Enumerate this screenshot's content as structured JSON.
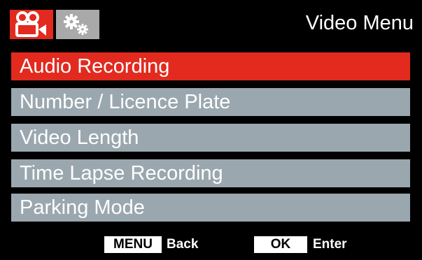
{
  "header": {
    "title": "Video Menu",
    "tabs": [
      {
        "icon": "video-camera-icon",
        "active": true
      },
      {
        "icon": "gears-icon",
        "active": false
      }
    ]
  },
  "menu": {
    "items": [
      {
        "label": "Audio Recording",
        "selected": true
      },
      {
        "label": "Number / Licence Plate",
        "selected": false
      },
      {
        "label": "Video Length",
        "selected": false
      },
      {
        "label": "Time Lapse Recording",
        "selected": false
      },
      {
        "label": "Parking Mode",
        "selected": false
      }
    ]
  },
  "footer": {
    "menu_key": "MENU",
    "menu_action": "Back",
    "ok_key": "OK",
    "ok_action": "Enter"
  },
  "colors": {
    "accent": "#e22a1f",
    "item": "#9aa7ae",
    "background": "#000000",
    "inactive_tab": "#a9a9a9"
  }
}
